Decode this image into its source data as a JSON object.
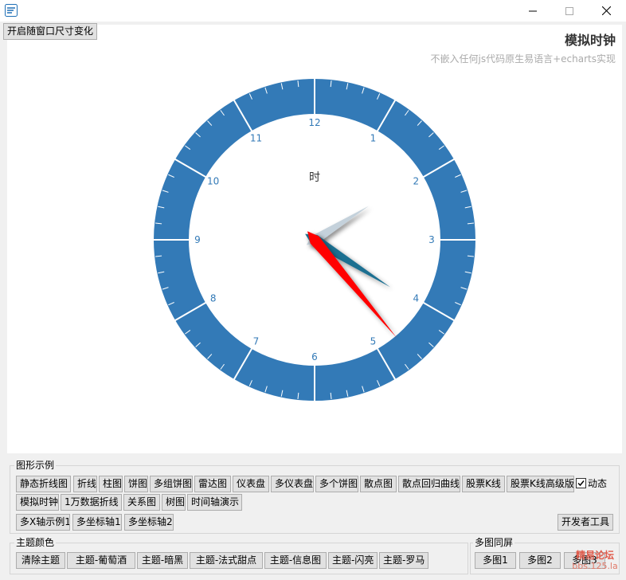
{
  "window": {
    "title": ""
  },
  "top_button": "开启随窗口尺寸变化",
  "chart_title": "模拟时钟",
  "chart_subtitle": "不嵌入任何js代码原生易语言+echarts实现",
  "clock": {
    "center_label": "时",
    "hour_labels": [
      "12",
      "1",
      "2",
      "3",
      "4",
      "5",
      "6",
      "7",
      "8",
      "9",
      "10",
      "11"
    ],
    "dial_color": "#337ab7",
    "hand_colors": {
      "hour": "#c4d1db",
      "minute": "#1d6f91",
      "second": "#ff0000"
    },
    "hand_angles_deg": {
      "hour": 58,
      "minute": 122,
      "second": 140
    }
  },
  "group_chart_examples": {
    "legend": "图形示例",
    "buttons": [
      "静态折线图",
      "折线",
      "柱图",
      "饼图",
      "多组饼图",
      "雷达图",
      "仪表盘",
      "多仪表盘",
      "多个饼图",
      "散点图",
      "散点回归曲线",
      "股票K线",
      "股票K线高级版",
      "模拟时钟",
      "1万数据折线",
      "关系图",
      "树图",
      "时间轴演示",
      "多X轴示例1",
      "多坐标轴1",
      "多坐标轴2"
    ],
    "dynamic_checkbox": {
      "label": "动态",
      "checked": true
    },
    "dev_tools": "开发者工具"
  },
  "group_theme": {
    "legend": "主题颜色",
    "buttons": [
      "清除主题",
      "主题-葡萄酒",
      "主题-暗黑",
      "主题-法式甜点",
      "主题-信息图",
      "主题-闪亮",
      "主题-罗马"
    ]
  },
  "group_multi": {
    "legend": "多图同屏",
    "buttons": [
      "多图1",
      "多图2",
      "多图3"
    ]
  },
  "watermark": {
    "line1": "精易论坛",
    "line2": "bbs.125.la"
  }
}
